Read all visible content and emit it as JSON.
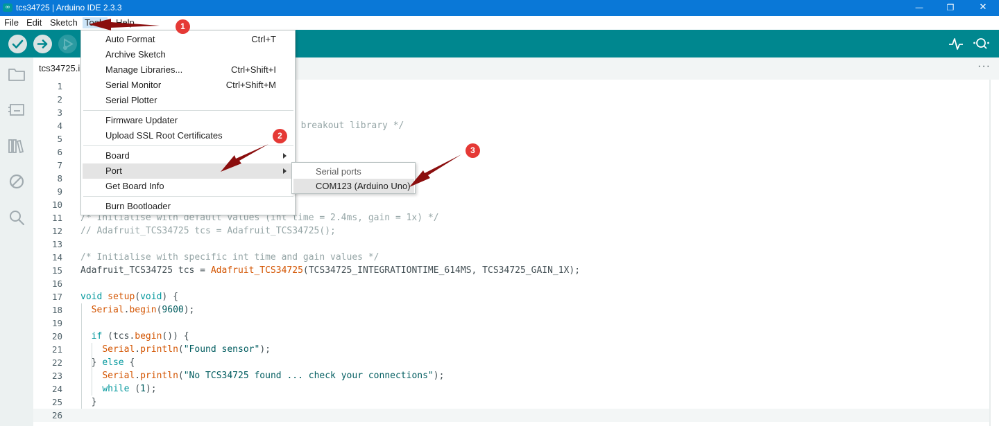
{
  "window": {
    "title": "tcs34725 | Arduino IDE 2.3.3",
    "app_icon": "∞",
    "min_glyph": "—",
    "max_glyph": "❐",
    "close_glyph": "✕"
  },
  "menubar": {
    "file": "File",
    "edit": "Edit",
    "sketch": "Sketch",
    "tools": "Tools",
    "help": "Help"
  },
  "toolbar": {
    "verify_icon": "checkmark-icon",
    "upload_icon": "arrow-right-icon",
    "debug_icon": "debug-icon",
    "serial_plotter_icon": "pulse-icon",
    "serial_monitor_icon": "magnifier-dots-icon"
  },
  "sidebar": {
    "icons": [
      "folder-icon",
      "board-icon",
      "library-icon",
      "debug-disabled-icon",
      "search-icon"
    ]
  },
  "editor": {
    "tab_label": "tcs34725.i",
    "more_glyph": "···",
    "line_numbers": [
      "1",
      "2",
      "3",
      "4",
      "5",
      "6",
      "7",
      "8",
      "9",
      "10",
      "11",
      "12",
      "13",
      "14",
      "15",
      "16",
      "17",
      "18",
      "19",
      "20",
      "21",
      "22",
      "23",
      "24",
      "25",
      "26"
    ],
    "visible_code": {
      "l4": "5 breakout library */",
      "l11": "/* Initialise with default values (int time = 2.4ms, gain = 1x) */",
      "l12": "// Adafruit_TCS34725 tcs = Adafruit_TCS34725();",
      "l14": "/* Initialise with specific int time and gain values */",
      "l15a": "Adafruit_TCS34725 tcs = ",
      "l15b": "Adafruit_TCS34725",
      "l15c": "(TCS34725_INTEGRATIONTIME_614MS, TCS34725_GAIN_1X);",
      "l17a": "void",
      "l17b": " ",
      "l17c": "setup",
      "l17d": "(",
      "l17e": "void",
      "l17f": ") {",
      "l18a": "  ",
      "l18b": "Serial",
      "l18c": ".",
      "l18d": "begin",
      "l18e": "(",
      "l18f": "9600",
      "l18g": ");",
      "l20a": "  ",
      "l20b": "if",
      "l20c": " (tcs.",
      "l20d": "begin",
      "l20e": "()) {",
      "l21a": "    ",
      "l21b": "Serial",
      "l21c": ".",
      "l21d": "println",
      "l21e": "(",
      "l21f": "\"Found sensor\"",
      "l21g": ");",
      "l22a": "  } ",
      "l22b": "else",
      "l22c": " {",
      "l23a": "    ",
      "l23b": "Serial",
      "l23c": ".",
      "l23d": "println",
      "l23e": "(",
      "l23f": "\"No TCS34725 found ... check your connections\"",
      "l23g": ");",
      "l24a": "    ",
      "l24b": "while",
      "l24c": " (",
      "l24d": "1",
      "l24e": ");",
      "l25": "  }"
    }
  },
  "tools_menu": {
    "items": [
      {
        "label": "Auto Format",
        "shortcut": "Ctrl+T"
      },
      {
        "label": "Archive Sketch",
        "shortcut": ""
      },
      {
        "label": "Manage Libraries...",
        "shortcut": "Ctrl+Shift+I"
      },
      {
        "label": "Serial Monitor",
        "shortcut": "Ctrl+Shift+M"
      },
      {
        "label": "Serial Plotter",
        "shortcut": ""
      },
      {
        "label": "Firmware Updater",
        "shortcut": ""
      },
      {
        "label": "Upload SSL Root Certificates",
        "shortcut": ""
      },
      {
        "label": "Board",
        "shortcut": ""
      },
      {
        "label": "Port",
        "shortcut": ""
      },
      {
        "label": "Get Board Info",
        "shortcut": ""
      },
      {
        "label": "Burn Bootloader",
        "shortcut": ""
      }
    ]
  },
  "port_menu": {
    "header": "Serial ports",
    "option": "COM123 (Arduino Uno)"
  },
  "annotations": {
    "badges": [
      "1",
      "2",
      "3"
    ],
    "badge_color": "#e53935",
    "arrow_color": "#8b0e0e"
  }
}
